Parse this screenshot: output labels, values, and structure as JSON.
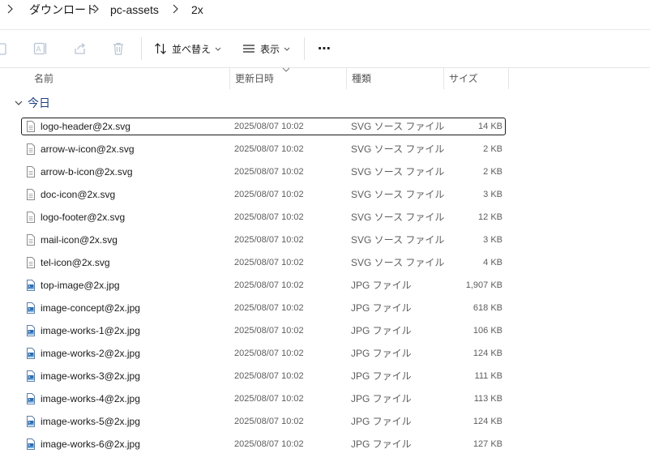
{
  "breadcrumb": [
    "ダウンロード",
    "pc-assets",
    "2x"
  ],
  "toolbar": {
    "sort_label": "並べ替え",
    "view_label": "表示",
    "more_label": "⋯"
  },
  "columns": {
    "name": "名前",
    "date": "更新日時",
    "type": "種類",
    "size": "サイズ"
  },
  "group": {
    "label": "今日"
  },
  "files": [
    {
      "name": "logo-header@2x.svg",
      "date": "2025/08/07 10:02",
      "type": "SVG ソース ファイル",
      "size": "14 KB",
      "kind": "svg",
      "selected": true
    },
    {
      "name": "arrow-w-icon@2x.svg",
      "date": "2025/08/07 10:02",
      "type": "SVG ソース ファイル",
      "size": "2 KB",
      "kind": "svg"
    },
    {
      "name": "arrow-b-icon@2x.svg",
      "date": "2025/08/07 10:02",
      "type": "SVG ソース ファイル",
      "size": "2 KB",
      "kind": "svg"
    },
    {
      "name": "doc-icon@2x.svg",
      "date": "2025/08/07 10:02",
      "type": "SVG ソース ファイル",
      "size": "3 KB",
      "kind": "svg"
    },
    {
      "name": "logo-footer@2x.svg",
      "date": "2025/08/07 10:02",
      "type": "SVG ソース ファイル",
      "size": "12 KB",
      "kind": "svg"
    },
    {
      "name": "mail-icon@2x.svg",
      "date": "2025/08/07 10:02",
      "type": "SVG ソース ファイル",
      "size": "3 KB",
      "kind": "svg"
    },
    {
      "name": "tel-icon@2x.svg",
      "date": "2025/08/07 10:02",
      "type": "SVG ソース ファイル",
      "size": "4 KB",
      "kind": "svg"
    },
    {
      "name": "top-image@2x.jpg",
      "date": "2025/08/07 10:02",
      "type": "JPG ファイル",
      "size": "1,907 KB",
      "kind": "jpg"
    },
    {
      "name": "image-concept@2x.jpg",
      "date": "2025/08/07 10:02",
      "type": "JPG ファイル",
      "size": "618 KB",
      "kind": "jpg"
    },
    {
      "name": "image-works-1@2x.jpg",
      "date": "2025/08/07 10:02",
      "type": "JPG ファイル",
      "size": "106 KB",
      "kind": "jpg"
    },
    {
      "name": "image-works-2@2x.jpg",
      "date": "2025/08/07 10:02",
      "type": "JPG ファイル",
      "size": "124 KB",
      "kind": "jpg"
    },
    {
      "name": "image-works-3@2x.jpg",
      "date": "2025/08/07 10:02",
      "type": "JPG ファイル",
      "size": "111 KB",
      "kind": "jpg"
    },
    {
      "name": "image-works-4@2x.jpg",
      "date": "2025/08/07 10:02",
      "type": "JPG ファイル",
      "size": "113 KB",
      "kind": "jpg"
    },
    {
      "name": "image-works-5@2x.jpg",
      "date": "2025/08/07 10:02",
      "type": "JPG ファイル",
      "size": "124 KB",
      "kind": "jpg"
    },
    {
      "name": "image-works-6@2x.jpg",
      "date": "2025/08/07 10:02",
      "type": "JPG ファイル",
      "size": "127 KB",
      "kind": "jpg"
    }
  ]
}
